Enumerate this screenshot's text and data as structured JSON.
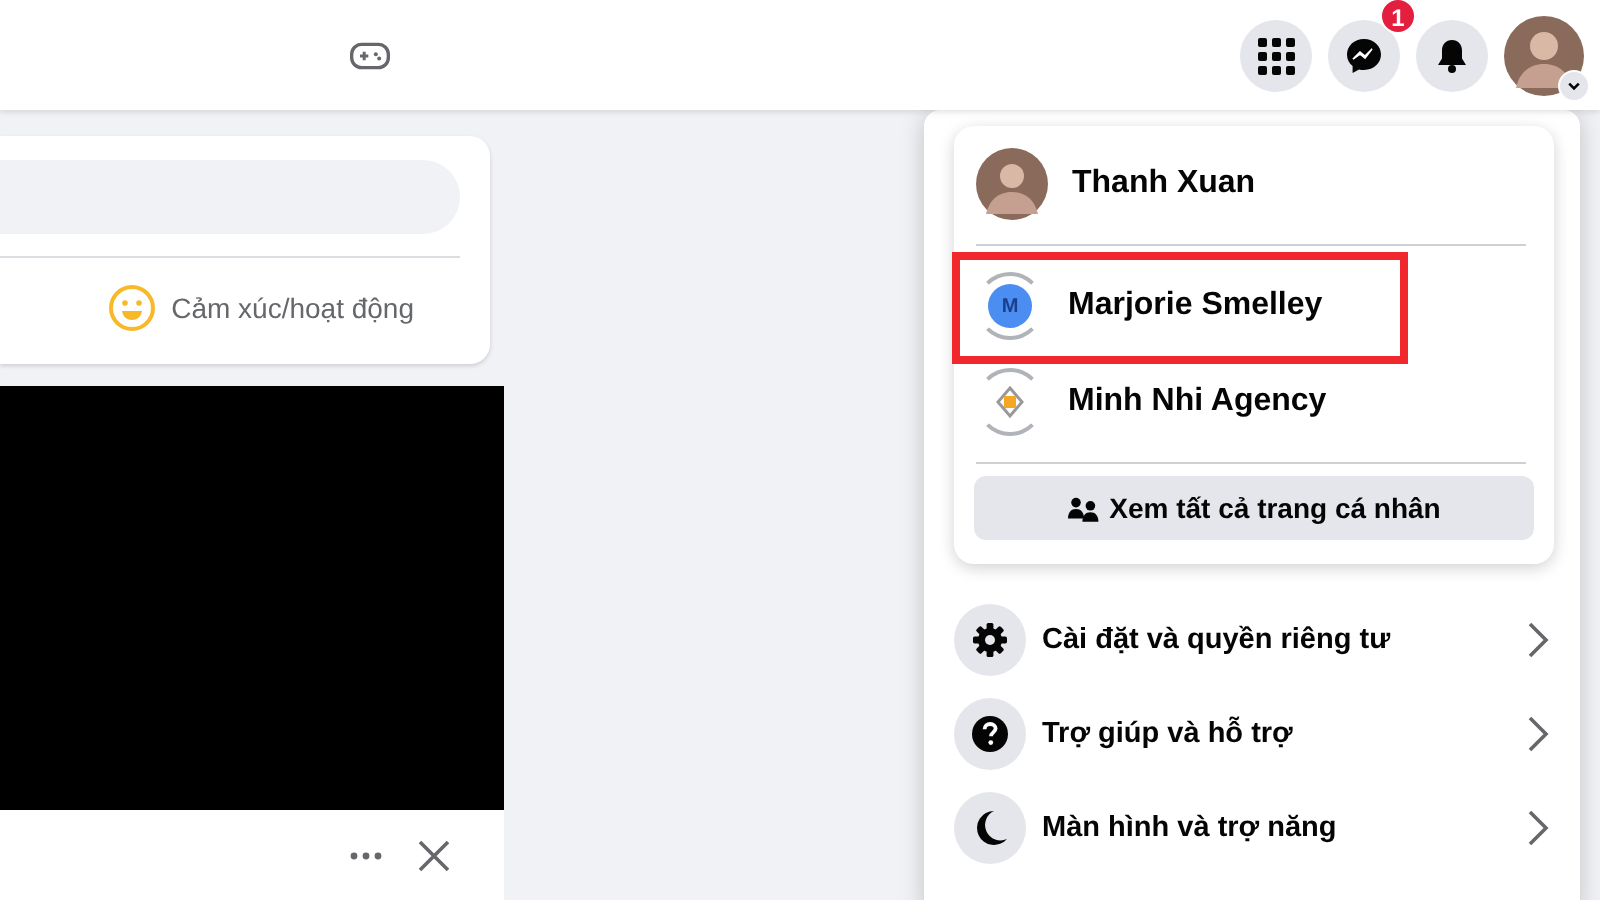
{
  "top_bar": {
    "notification_badge": "1"
  },
  "composer": {
    "feeling_label": "Cảm xúc/hoạt động"
  },
  "account_menu": {
    "profiles": [
      {
        "name": "Thanh Xuan",
        "kind": "photo",
        "highlighted": false
      },
      {
        "name": "Marjorie Smelley",
        "kind": "initial",
        "initial": "M",
        "highlighted": true
      },
      {
        "name": "Minh Nhi Agency",
        "kind": "logo",
        "highlighted": false
      }
    ],
    "see_all_button": "Xem tất cả trang cá nhân",
    "items": [
      {
        "label": "Cài đặt và quyền riêng tư",
        "kind": "settings"
      },
      {
        "label": "Trợ giúp và hỗ trợ",
        "kind": "help"
      },
      {
        "label": "Màn hình và trợ năng",
        "kind": "display"
      }
    ]
  }
}
